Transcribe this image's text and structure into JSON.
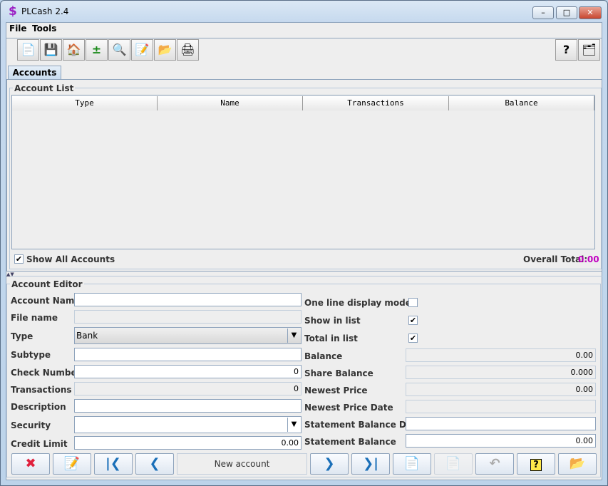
{
  "window": {
    "title": "PLCash 2.4",
    "icon": "dollar-icon"
  },
  "menu": [
    "File",
    "Tools"
  ],
  "toolbar": [
    "new-icon",
    "save-icon",
    "home-icon",
    "plus-minus-icon",
    "search-icon",
    "edit-icon",
    "open-icon",
    "print-icon"
  ],
  "toolbar_right": [
    "help-icon",
    "settings-icon"
  ],
  "tab": "Accounts",
  "account_list": {
    "title": "Account List",
    "columns": [
      "Type",
      "Name",
      "Transactions",
      "Balance"
    ],
    "show_all_label": "Show All Accounts",
    "show_all": true,
    "overall_total_label": "Overall Total:",
    "overall_total": "0.00",
    "total_color": "#c000c0"
  },
  "editor": {
    "title": "Account Editor",
    "left": [
      {
        "label": "Account Name",
        "value": ""
      },
      {
        "label": "File name",
        "value": ""
      },
      {
        "label": "Type",
        "value": "Bank"
      },
      {
        "label": "Subtype",
        "value": ""
      },
      {
        "label": "Check Number",
        "value": "0"
      },
      {
        "label": "Transactions",
        "value": "0"
      },
      {
        "label": "Description",
        "value": ""
      },
      {
        "label": "Security",
        "value": ""
      },
      {
        "label": "Credit Limit",
        "value": "0.00"
      }
    ],
    "right_checks": [
      {
        "label": "One line display mode",
        "checked": false
      },
      {
        "label": "Show in list",
        "checked": true
      },
      {
        "label": "Total in list",
        "checked": true
      }
    ],
    "right_fields": [
      {
        "label": "Balance",
        "value": "0.00"
      },
      {
        "label": "Share Balance",
        "value": "0.000"
      },
      {
        "label": "Newest Price",
        "value": "0.00"
      },
      {
        "label": "Newest Price Date",
        "value": ""
      },
      {
        "label": "Statement Balance Date",
        "value": ""
      },
      {
        "label": "Statement Balance",
        "value": "0.00"
      }
    ]
  },
  "buttons": {
    "status": "New account"
  }
}
